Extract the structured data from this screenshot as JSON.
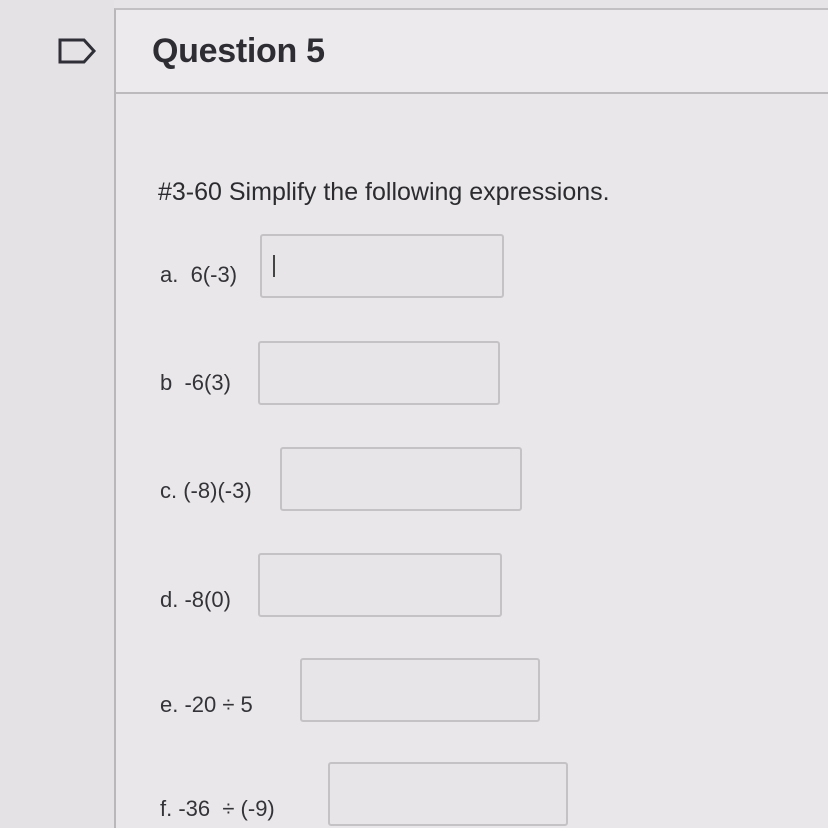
{
  "question": {
    "title": "Question 5",
    "instructions": "#3-60 Simplify the following expressions."
  },
  "items": [
    {
      "label": "a.  6(-3)",
      "value": ""
    },
    {
      "label": "b  -6(3)",
      "value": ""
    },
    {
      "label": "c. (-8)(-3)",
      "value": ""
    },
    {
      "label": "d. -8(0)",
      "value": ""
    },
    {
      "label": "e. -20 ÷ 5",
      "value": ""
    },
    {
      "label": "f. -36  ÷ (-9)",
      "value": ""
    }
  ],
  "icons": {
    "flag": "flag-icon"
  }
}
